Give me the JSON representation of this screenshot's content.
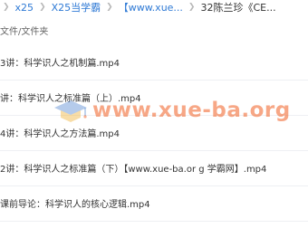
{
  "breadcrumb": {
    "items": [
      "x25",
      "X25当学霸",
      "【www.xue...",
      "32陈兰珍《CE..."
    ]
  },
  "list": {
    "header": "文件/文件夹",
    "files": [
      "3讲：科学识人之机制篇.mp4",
      "讲：科学识人之标准篇（上）.mp4",
      "4讲：科学识人之方法篇.mp4",
      "2讲：科学识人之标准篇（下）【www.xue-ba.or g 学霸网】.mp4",
      "课前导论：科学识人的核心逻辑.mp4"
    ]
  },
  "watermark": {
    "text": "www.xue-ba.org"
  },
  "colors": {
    "link": "#2f7ad5",
    "watermark": "#f05f23"
  }
}
